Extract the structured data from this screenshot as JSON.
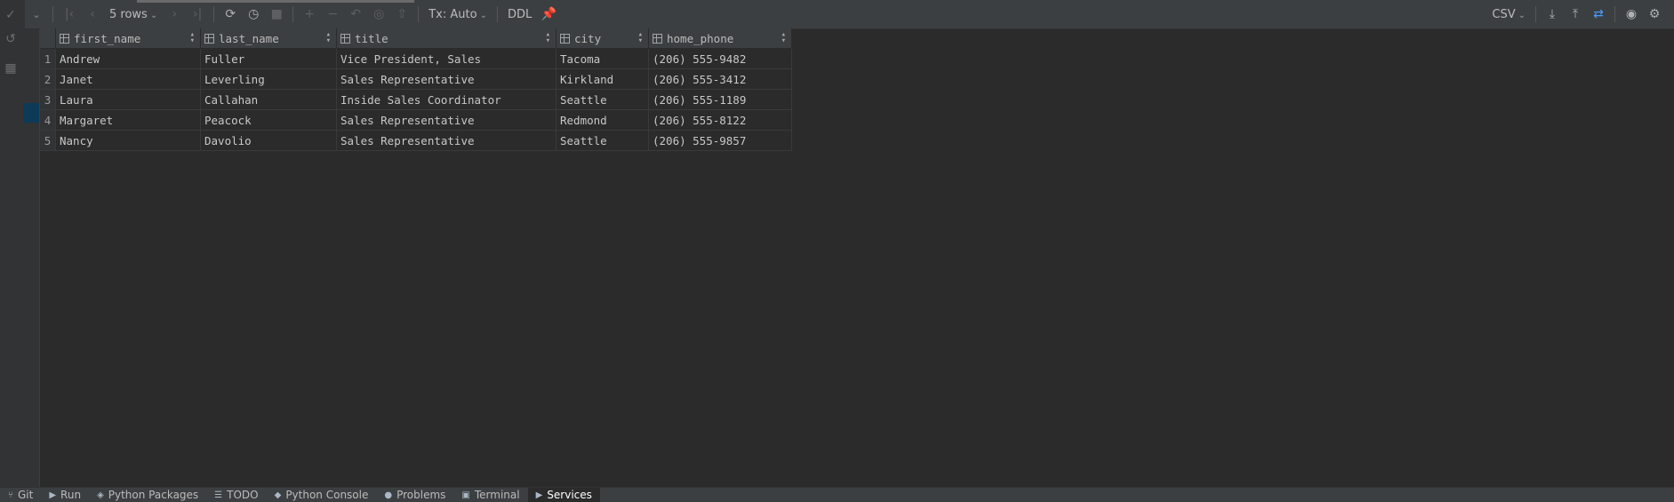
{
  "toolbar": {
    "rows_label": "5 rows",
    "tx_label": "Tx: Auto",
    "ddl_label": "DDL",
    "export_format": "CSV"
  },
  "grid": {
    "columns": [
      "first_name",
      "last_name",
      "title",
      "city",
      "home_phone"
    ],
    "rows": [
      {
        "num": "1",
        "cells": [
          "Andrew",
          "Fuller",
          "Vice President, Sales",
          "Tacoma",
          "(206) 555-9482"
        ]
      },
      {
        "num": "2",
        "cells": [
          "Janet",
          "Leverling",
          "Sales Representative",
          "Kirkland",
          "(206) 555-3412"
        ]
      },
      {
        "num": "3",
        "cells": [
          "Laura",
          "Callahan",
          "Inside Sales Coordinator",
          "Seattle",
          "(206) 555-1189"
        ]
      },
      {
        "num": "4",
        "cells": [
          "Margaret",
          "Peacock",
          "Sales Representative",
          "Redmond",
          "(206) 555-8122"
        ]
      },
      {
        "num": "5",
        "cells": [
          "Nancy",
          "Davolio",
          "Sales Representative",
          "Seattle",
          "(206) 555-9857"
        ]
      }
    ]
  },
  "statusbar": {
    "items": [
      "Git",
      "Run",
      "Python Packages",
      "TODO",
      "Python Console",
      "Problems",
      "Terminal",
      "Services"
    ],
    "active": "Services"
  },
  "colors": {
    "background": "#2b2b2b",
    "toolbar": "#3c3f41",
    "selection": "#0d3a58",
    "accent": "#4a9eff"
  }
}
